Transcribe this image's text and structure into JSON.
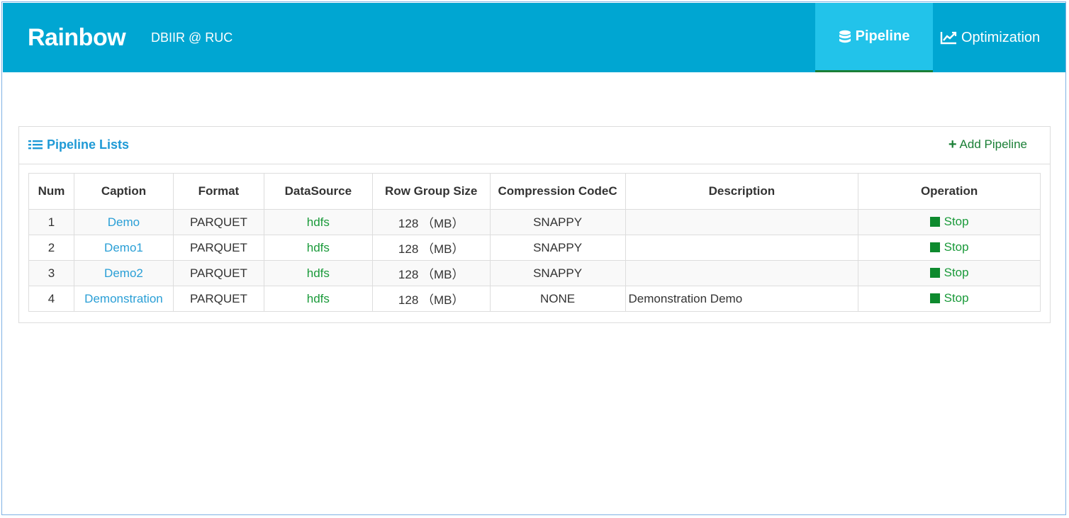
{
  "header": {
    "brand": "Rainbow",
    "subtitle": "DBIIR @ RUC",
    "nav": [
      {
        "label": "Pipeline",
        "icon": "database-icon",
        "active": true
      },
      {
        "label": "Optimization",
        "icon": "line-chart-icon",
        "active": false
      }
    ]
  },
  "panel": {
    "title": "Pipeline Lists",
    "add_label": "Add Pipeline"
  },
  "table": {
    "columns": [
      "Num",
      "Caption",
      "Format",
      "DataSource",
      "Row Group Size",
      "Compression CodeC",
      "Description",
      "Operation"
    ],
    "rows": [
      {
        "num": "1",
        "caption": "Demo",
        "format": "PARQUET",
        "source": "hdfs",
        "size": "128 （MB）",
        "codec": "SNAPPY",
        "description": "",
        "operation": "Stop"
      },
      {
        "num": "2",
        "caption": "Demo1",
        "format": "PARQUET",
        "source": "hdfs",
        "size": "128 （MB）",
        "codec": "SNAPPY",
        "description": "",
        "operation": "Stop"
      },
      {
        "num": "3",
        "caption": "Demo2",
        "format": "PARQUET",
        "source": "hdfs",
        "size": "128 （MB）",
        "codec": "SNAPPY",
        "description": "",
        "operation": "Stop"
      },
      {
        "num": "4",
        "caption": "Demonstration",
        "format": "PARQUET",
        "source": "hdfs",
        "size": "128 （MB）",
        "codec": "NONE",
        "description": "Demonstration Demo",
        "operation": "Stop"
      }
    ]
  },
  "colors": {
    "navbar": "#00a6d2",
    "nav_active": "#22c3ea",
    "link": "#2a9fd6",
    "green": "#1a9a3a"
  }
}
